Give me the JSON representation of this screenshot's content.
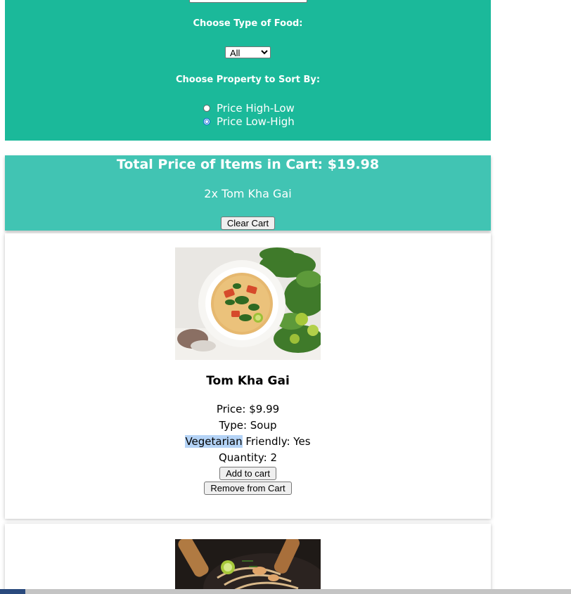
{
  "filters": {
    "type_label": "Choose Type of Food:",
    "type_selected": "All",
    "sort_label": "Choose Property to Sort By:",
    "sort_options": [
      {
        "label": "Price High-Low",
        "checked": false
      },
      {
        "label": "Price Low-High",
        "checked": true
      }
    ]
  },
  "cart": {
    "total_text": "Total Price of Items in Cart: $19.98",
    "items": [
      "2x Tom Kha Gai"
    ],
    "clear_label": "Clear Cart"
  },
  "items": [
    {
      "name": "Tom Kha Gai",
      "price_text": "Price: $9.99",
      "type_text": "Type: Soup",
      "veg_word": "Vegetarian",
      "veg_rest": " Friendly: Yes",
      "quantity_text": "Quantity: 2",
      "add_label": "Add to cart",
      "remove_label": "Remove from Cart"
    }
  ],
  "colors": {
    "filter_bg": "#1bb99a",
    "cart_bg": "#41c4b3",
    "selection_highlight": "#b4d3f6"
  }
}
